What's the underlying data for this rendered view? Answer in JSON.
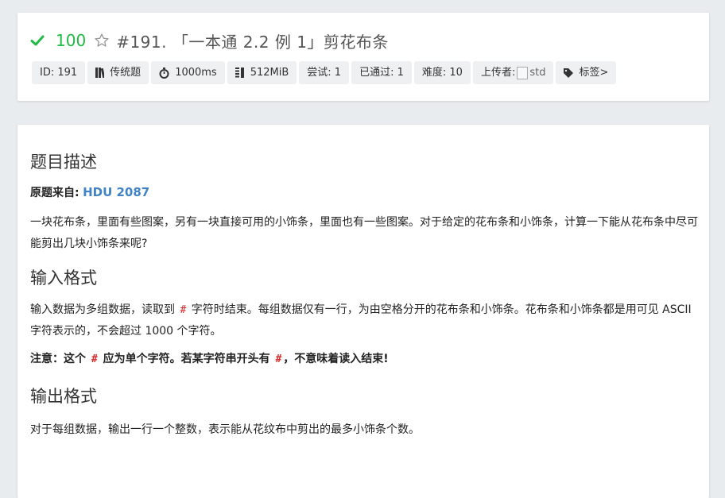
{
  "header": {
    "score": "100",
    "title": "#191. 「一本通 2.2 例 1」剪花布条",
    "tags": [
      {
        "icon": "id",
        "text": "ID: 191"
      },
      {
        "icon": "book-icon",
        "text": "传统题"
      },
      {
        "icon": "stopwatch-icon",
        "text": "1000ms"
      },
      {
        "icon": "memory-icon",
        "text": "512MiB"
      },
      {
        "icon": "",
        "text": "尝试: 1"
      },
      {
        "icon": "",
        "text": "已通过: 1"
      },
      {
        "icon": "",
        "text": "难度: 10"
      },
      {
        "icon": "",
        "text": "上传者:"
      },
      {
        "icon": "tag-icon",
        "text": "标签>"
      }
    ],
    "uploader_alt": "std"
  },
  "content": {
    "desc_title": "题目描述",
    "source_label": "原题来自:",
    "source_link": "HDU 2087",
    "desc_text": "一块花布条，里面有些图案，另有一块直接可用的小饰条，里面也有一些图案。对于给定的花布条和小饰条，计算一下能从花布条中尽可能剪出几块小饰条来呢?",
    "input_title": "输入格式",
    "input_p1_a": "输入数据为多组数据，读取到 ",
    "input_hash": "#",
    "input_p1_b": " 字符时结束。每组数据仅有一行，为由空格分开的花布条和小饰条。花布条和小饰条都是用可见 ASCII 字符表示的，不会超过 1000 个字符。",
    "note_a": "注意：这个 ",
    "note_b": " 应为单个字符。若某字符串开头有 ",
    "note_c": "，不意味着读入结束!",
    "output_title": "输出格式",
    "output_text": "对于每组数据，输出一行一个整数，表示能从花纹布中剪出的最多小饰条个数。"
  },
  "colors": {
    "accent_green": "#21ba45",
    "link": "#4183c4",
    "hash": "#db2828"
  }
}
